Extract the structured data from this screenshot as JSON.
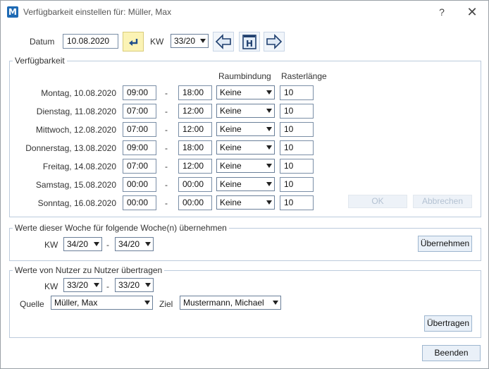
{
  "window": {
    "title": "Verfügbarkeit einstellen für: Müller, Max",
    "help": "?",
    "close": "✕",
    "app_icon_letter": "M"
  },
  "top": {
    "datum_label": "Datum",
    "datum_value": "10.08.2020",
    "kw_label": "KW",
    "kw_value": "33/20"
  },
  "availability": {
    "legend": "Verfügbarkeit",
    "col_room": "Raumbindung",
    "col_raster": "Rasterlänge",
    "days": [
      {
        "label": "Montag, 10.08.2020",
        "from": "09:00",
        "to": "18:00",
        "room": "Keine",
        "raster": "10"
      },
      {
        "label": "Dienstag, 11.08.2020",
        "from": "07:00",
        "to": "12:00",
        "room": "Keine",
        "raster": "10"
      },
      {
        "label": "Mittwoch, 12.08.2020",
        "from": "07:00",
        "to": "12:00",
        "room": "Keine",
        "raster": "10"
      },
      {
        "label": "Donnerstag, 13.08.2020",
        "from": "09:00",
        "to": "18:00",
        "room": "Keine",
        "raster": "10"
      },
      {
        "label": "Freitag, 14.08.2020",
        "from": "07:00",
        "to": "12:00",
        "room": "Keine",
        "raster": "10"
      },
      {
        "label": "Samstag, 15.08.2020",
        "from": "00:00",
        "to": "00:00",
        "room": "Keine",
        "raster": "10"
      },
      {
        "label": "Sonntag, 16.08.2020",
        "from": "00:00",
        "to": "00:00",
        "room": "Keine",
        "raster": "10"
      }
    ],
    "dash": "-",
    "ok": "OK",
    "cancel": "Abbrechen"
  },
  "copy_week": {
    "legend": "Werte dieser Woche für folgende Woche(n) übernehmen",
    "kw_label": "KW",
    "kw_from": "34/20",
    "kw_to": "34/20",
    "dash": "-",
    "button": "Übernehmen"
  },
  "transfer": {
    "legend": "Werte von Nutzer zu Nutzer übertragen",
    "kw_label": "KW",
    "kw_from": "33/20",
    "kw_to": "33/20",
    "dash": "-",
    "source_label": "Quelle",
    "source_value": "Müller, Max",
    "target_label": "Ziel",
    "target_value": "Mustermann, Michael",
    "button": "Übertragen"
  },
  "footer": {
    "close_button": "Beenden"
  }
}
